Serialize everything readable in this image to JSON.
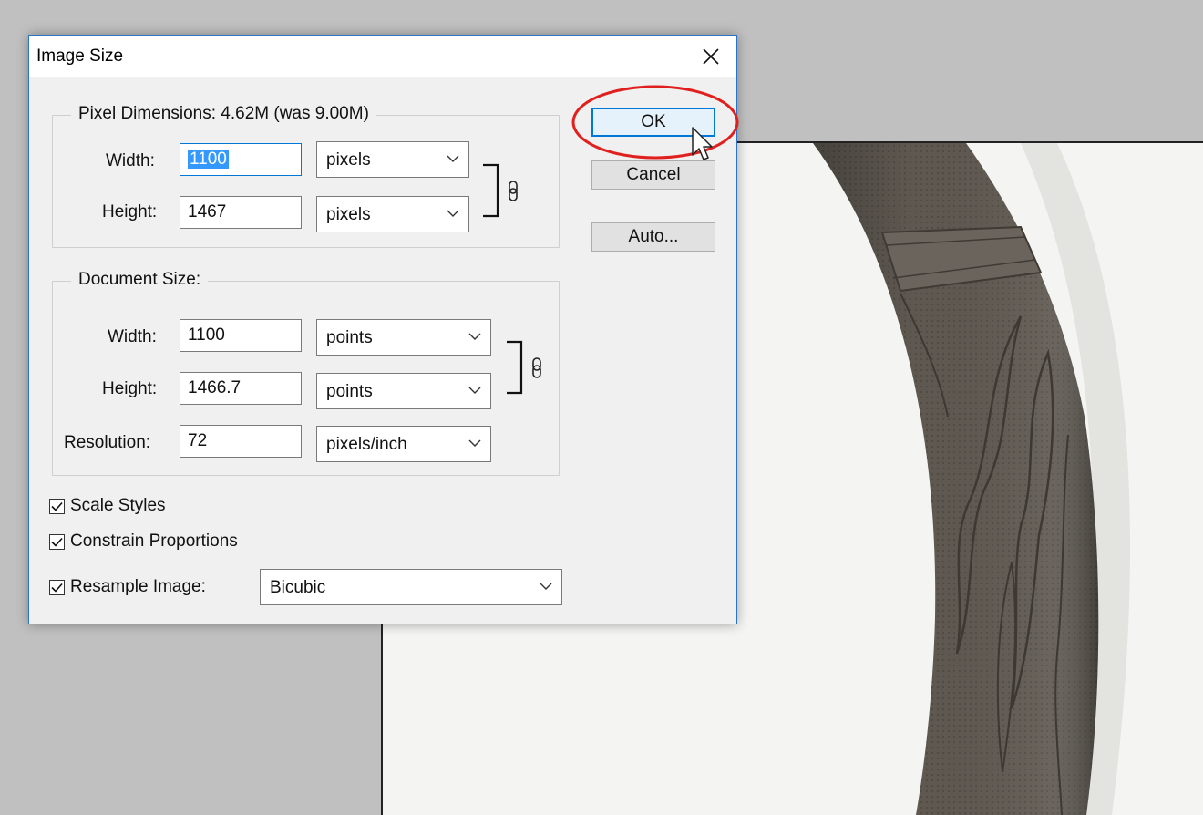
{
  "dialog": {
    "title": "Image Size",
    "pixel_dimensions": {
      "legend": "Pixel Dimensions:  4.62M (was 9.00M)",
      "width_label": "Width:",
      "width_value": "1100",
      "width_unit": "pixels",
      "height_label": "Height:",
      "height_value": "1467",
      "height_unit": "pixels"
    },
    "document_size": {
      "legend": "Document Size:",
      "width_label": "Width:",
      "width_value": "1100",
      "width_unit": "points",
      "height_label": "Height:",
      "height_value": "1466.7",
      "height_unit": "points",
      "resolution_label": "Resolution:",
      "resolution_value": "72",
      "resolution_unit": "pixels/inch"
    },
    "options": {
      "scale_styles": {
        "label": "Scale Styles",
        "checked": true
      },
      "constrain_proportions": {
        "label": "Constrain Proportions",
        "checked": true
      },
      "resample_image": {
        "label": "Resample Image:",
        "checked": true,
        "method": "Bicubic"
      }
    },
    "buttons": {
      "ok": "OK",
      "cancel": "Cancel",
      "auto": "Auto..."
    }
  },
  "colors": {
    "accent": "#0078d7",
    "highlight_circle": "#e0201e",
    "workspace_bg": "#c0c0c0",
    "canvas_bg": "#f4f4f2",
    "object": "#5e5850"
  },
  "icons": [
    "close-icon",
    "chain-link-icon",
    "chevron-down-icon",
    "checkmark-icon",
    "mouse-pointer-icon"
  ]
}
